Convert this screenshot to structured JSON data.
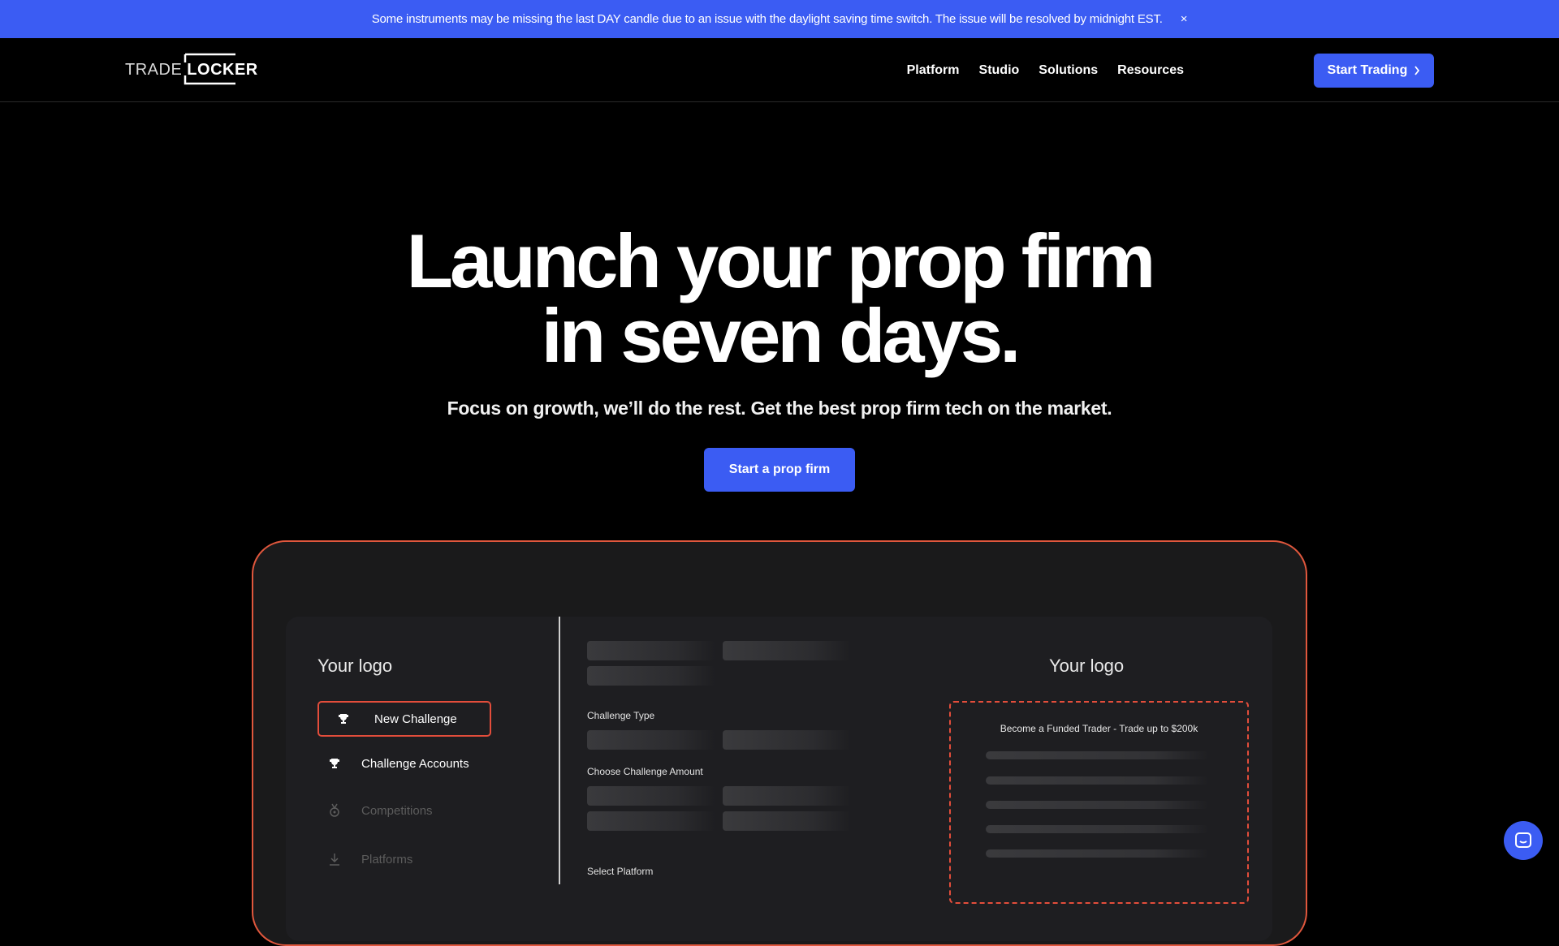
{
  "banner": {
    "message": "Some instruments may be missing the last DAY candle due to an issue with the daylight saving time switch. The issue will be resolved by midnight EST.",
    "close_label": "×"
  },
  "nav": {
    "logo_trade": "TRADE",
    "logo_locker": "LOCKER",
    "links": [
      "Platform",
      "Studio",
      "Solutions",
      "Resources"
    ],
    "cta_label": "Start Trading"
  },
  "hero": {
    "title_line1": "Launch your prop firm",
    "title_line2": "in seven days.",
    "subtitle": "Focus on growth, we’ll do the rest. Get the best prop firm tech on the market.",
    "cta_label": "Start a prop firm"
  },
  "mockup": {
    "left_logo": "Your logo",
    "right_logo": "Your logo",
    "sidebar": {
      "items": [
        {
          "label": "New Challenge",
          "icon": "trophy-icon"
        },
        {
          "label": "Challenge Accounts",
          "icon": "trophy-icon"
        },
        {
          "label": "Competitions",
          "icon": "medal-icon"
        },
        {
          "label": "Platforms",
          "icon": "download-icon"
        }
      ]
    },
    "form": {
      "challenge_type_label": "Challenge Type",
      "challenge_amount_label": "Choose Challenge Amount",
      "select_platform_label": "Select Platform"
    },
    "card": {
      "title": "Become a Funded Trader - Trade up to $200k"
    }
  },
  "colors": {
    "accent_blue": "#3b5cf3",
    "gradient_red": "#e63a3a",
    "gradient_orange": "#f58b3a"
  }
}
